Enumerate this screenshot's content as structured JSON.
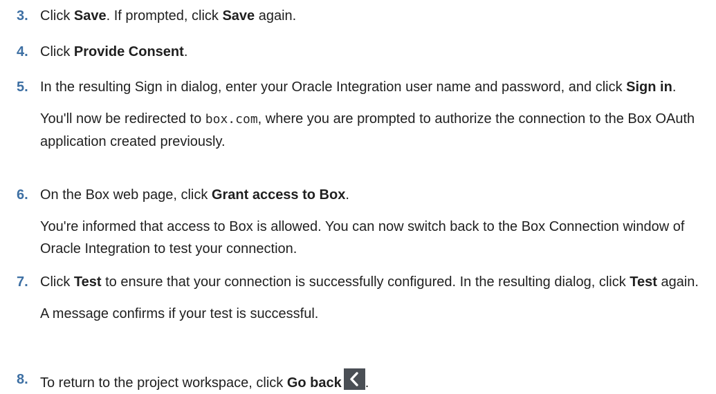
{
  "steps": [
    {
      "num": "3.",
      "t1": "Click ",
      "b1": "Save",
      "t2": ". If prompted, click ",
      "b2": "Save",
      "t3": " again."
    },
    {
      "num": "4.",
      "t1": "Click ",
      "b1": "Provide Consent",
      "t2": "."
    },
    {
      "num": "5.",
      "t1": "In the resulting Sign in dialog, enter your Oracle Integration user name and password, and click ",
      "b1": "Sign in",
      "t2": ".",
      "note_t1": "You'll now be redirected to ",
      "note_code": "box.com",
      "note_t2": ", where you are prompted to authorize the connection to the Box OAuth application created previously."
    },
    {
      "num": "6.",
      "t1": "On the Box web page, click ",
      "b1": "Grant access to Box",
      "t2": ".",
      "note": "You're informed that access to Box is allowed. You can now switch back to the Box Connection window of Oracle Integration to test your connection."
    },
    {
      "num": "7.",
      "t1": "Click ",
      "b1": "Test",
      "t2": " to ensure that your connection is successfully configured. In the resulting dialog, click ",
      "b2": "Test",
      "t3": " again.",
      "note": "A message confirms if your test is successful."
    },
    {
      "num": "8.",
      "t1": "To return to the project workspace, click ",
      "b1": "Go back",
      "icon": "chevron-left-icon",
      "t2": "."
    }
  ]
}
